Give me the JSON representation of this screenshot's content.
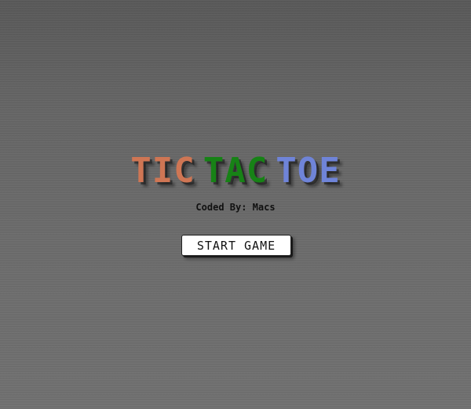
{
  "title": {
    "word1": "TIC",
    "word2": "TAC",
    "word3": "TOE"
  },
  "credit": "Coded By: Macs",
  "start_button_label": "START GAME",
  "colors": {
    "tic": "#cf7654",
    "tac": "#178216",
    "toe": "#6f84d8",
    "background": "#666666",
    "button_bg": "#ffffff"
  }
}
